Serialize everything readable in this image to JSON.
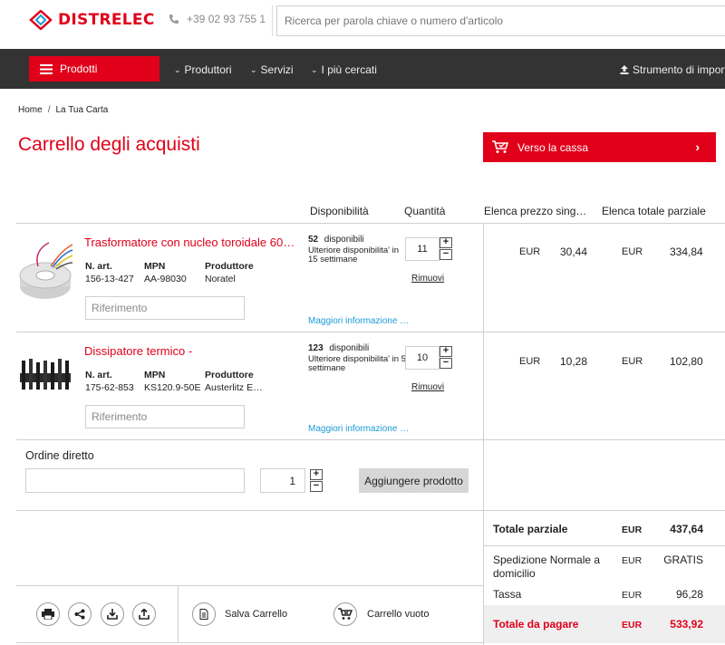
{
  "header": {
    "logo_text": "DISTRELEC",
    "phone": "+39 02 93 755 1",
    "search_placeholder": "Ricerca per parola chiave o numero d'articolo"
  },
  "nav": {
    "products": "Prodotti",
    "producers": "Produttori",
    "services": "Servizi",
    "most_searched": "I più cercati",
    "import_tool": "Strumento di importa"
  },
  "breadcrumb": {
    "home": "Home",
    "sep": "/",
    "current": "La Tua Carta"
  },
  "page_title": "Carrello degli acquisti",
  "checkout_label": "Verso la cassa",
  "table_headers": {
    "availability": "Disponibilità",
    "quantity": "Quantità",
    "unit_price": "Elenca prezzo sing…",
    "subtotal": "Elenca totale parziale"
  },
  "labels": {
    "art_no": "N. art.",
    "mpn": "MPN",
    "producer": "Produttore",
    "reference_placeholder": "Riferimento",
    "available": "disponibili",
    "remove": "Rimuovi",
    "more_info": "Maggiori informazione …"
  },
  "items": [
    {
      "name": "Trasformatore con nucleo toroidale 60…",
      "art_no": "156-13-427",
      "mpn": "AA-98030",
      "producer": "Noratel",
      "stock": "52",
      "stock_more": "Ulteriore disponibilita' in 15 settimane",
      "qty": "11",
      "currency": "EUR",
      "unit_price": "30,44",
      "subtotal": "334,84"
    },
    {
      "name": "Dissipatore termico -",
      "art_no": "175-62-853",
      "mpn": "KS120.9-50E",
      "producer": "Austerlitz E…",
      "stock": "123",
      "stock_more": "Ulteriore disponibilita' in 5 settimane",
      "qty": "10",
      "currency": "EUR",
      "unit_price": "10,28",
      "subtotal": "102,80"
    }
  ],
  "direct_order": {
    "title": "Ordine diretto",
    "qty": "1",
    "add_label": "Aggiungere prodotto"
  },
  "totals": {
    "subtotal_label": "Totale parziale",
    "subtotal_cur": "EUR",
    "subtotal_amt": "437,64",
    "shipping_label": "Spedizione Normale a domicilio",
    "shipping_cur": "EUR",
    "shipping_amt": "GRATIS",
    "tax_label": "Tassa",
    "tax_cur": "EUR",
    "tax_amt": "96,28",
    "total_label": "Totale da pagare",
    "total_cur": "EUR",
    "total_amt": "533,92"
  },
  "tools": {
    "save_cart": "Salva Carrello",
    "empty_cart": "Carrello vuoto"
  },
  "colors": {
    "brand_red": "#e1001a",
    "nav_dark": "#333333",
    "link_blue": "#1a9bd7"
  }
}
